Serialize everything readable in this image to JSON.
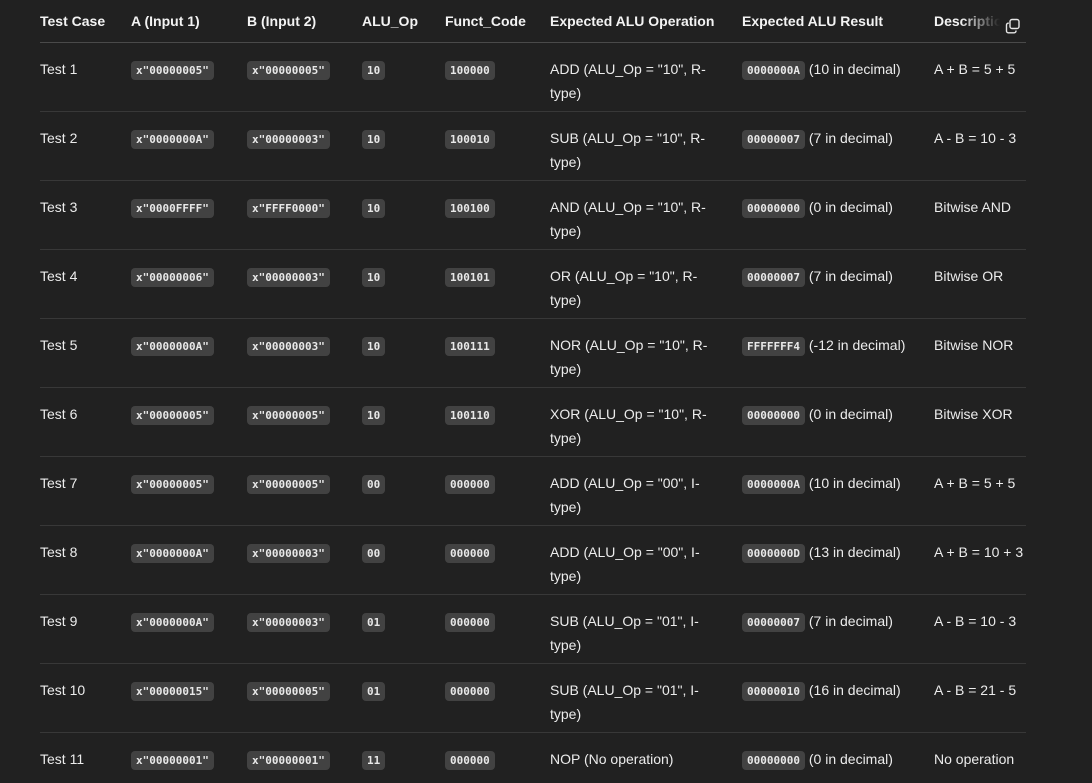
{
  "table": {
    "headers": [
      "Test Case",
      "A (Input 1)",
      "B (Input 2)",
      "ALU_Op",
      "Funct_Code",
      "Expected ALU Operation",
      "Expected ALU Result",
      "Descriptio"
    ],
    "rows": [
      {
        "test": "Test 1",
        "a": "x\"00000005\"",
        "b": "x\"00000005\"",
        "aluop": "10",
        "funct": "100000",
        "op": "ADD (ALU_Op = \"10\", R-type)",
        "res_code": "0000000A",
        "res_text": "(10 in decimal)",
        "desc": "A + B = 5 + 5"
      },
      {
        "test": "Test 2",
        "a": "x\"0000000A\"",
        "b": "x\"00000003\"",
        "aluop": "10",
        "funct": "100010",
        "op": "SUB (ALU_Op = \"10\", R-type)",
        "res_code": "00000007",
        "res_text": "(7 in decimal)",
        "desc": "A - B = 10 - 3"
      },
      {
        "test": "Test 3",
        "a": "x\"0000FFFF\"",
        "b": "x\"FFFF0000\"",
        "aluop": "10",
        "funct": "100100",
        "op": "AND (ALU_Op = \"10\", R-type)",
        "res_code": "00000000",
        "res_text": "(0 in decimal)",
        "desc": "Bitwise AND"
      },
      {
        "test": "Test 4",
        "a": "x\"00000006\"",
        "b": "x\"00000003\"",
        "aluop": "10",
        "funct": "100101",
        "op": "OR (ALU_Op = \"10\", R-type)",
        "res_code": "00000007",
        "res_text": "(7 in decimal)",
        "desc": "Bitwise OR"
      },
      {
        "test": "Test 5",
        "a": "x\"0000000A\"",
        "b": "x\"00000003\"",
        "aluop": "10",
        "funct": "100111",
        "op": "NOR (ALU_Op = \"10\", R-type)",
        "res_code": "FFFFFFF4",
        "res_text": "(-12 in decimal)",
        "desc": "Bitwise NOR"
      },
      {
        "test": "Test 6",
        "a": "x\"00000005\"",
        "b": "x\"00000005\"",
        "aluop": "10",
        "funct": "100110",
        "op": "XOR (ALU_Op = \"10\", R-type)",
        "res_code": "00000000",
        "res_text": "(0 in decimal)",
        "desc": "Bitwise XOR"
      },
      {
        "test": "Test 7",
        "a": "x\"00000005\"",
        "b": "x\"00000005\"",
        "aluop": "00",
        "funct": "000000",
        "op": "ADD (ALU_Op = \"00\", I-type)",
        "res_code": "0000000A",
        "res_text": "(10 in decimal)",
        "desc": "A + B = 5 + 5"
      },
      {
        "test": "Test 8",
        "a": "x\"0000000A\"",
        "b": "x\"00000003\"",
        "aluop": "00",
        "funct": "000000",
        "op": "ADD (ALU_Op = \"00\", I-type)",
        "res_code": "0000000D",
        "res_text": "(13 in decimal)",
        "desc": "A + B = 10 + 3"
      },
      {
        "test": "Test 9",
        "a": "x\"0000000A\"",
        "b": "x\"00000003\"",
        "aluop": "01",
        "funct": "000000",
        "op": "SUB (ALU_Op = \"01\", I-type)",
        "res_code": "00000007",
        "res_text": "(7 in decimal)",
        "desc": "A - B = 10 - 3"
      },
      {
        "test": "Test 10",
        "a": "x\"00000015\"",
        "b": "x\"00000005\"",
        "aluop": "01",
        "funct": "000000",
        "op": "SUB (ALU_Op = \"01\", I-type)",
        "res_code": "00000010",
        "res_text": "(16 in decimal)",
        "desc": "A - B = 21 - 5"
      },
      {
        "test": "Test 11",
        "a": "x\"00000001\"",
        "b": "x\"00000001\"",
        "aluop": "11",
        "funct": "000000",
        "op": "NOP (No operation)",
        "res_code": "00000000",
        "res_text": "(0 in decimal)",
        "desc": "No operation"
      }
    ]
  },
  "copy_button": {
    "icon": "copy-icon"
  }
}
